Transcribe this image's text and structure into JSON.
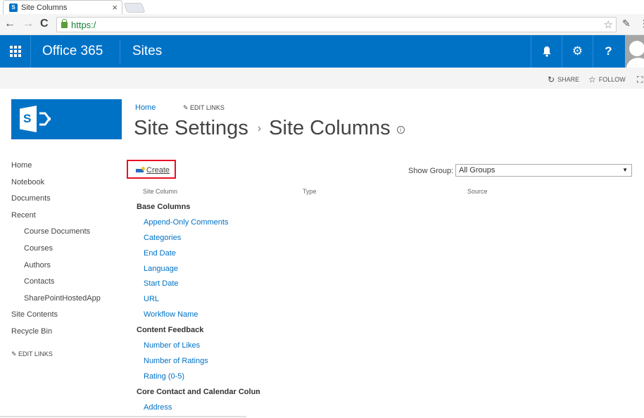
{
  "browser": {
    "tab_title": "Site Columns",
    "tab_favicon": "S",
    "url": "https:/",
    "back_icon": "←",
    "forward_icon": "→",
    "reload_icon": "C",
    "star_icon": "☆",
    "close_icon": "×"
  },
  "suite_bar": {
    "brand": "Office 365",
    "app": "Sites",
    "bell_icon": "🔔",
    "gear_icon": "⚙",
    "help_icon": "?",
    "colors": {
      "bar": "#0072c6"
    }
  },
  "share_bar": {
    "share_label": "SHARE",
    "follow_label": "FOLLOW"
  },
  "header": {
    "breadcrumb_home": "Home",
    "edit_links": "EDIT LINKS",
    "title_parent": "Site Settings",
    "title_separator": "›",
    "title_current": "Site Columns",
    "info_icon": "i"
  },
  "quick_launch": {
    "items": [
      {
        "label": "Home",
        "sub": false
      },
      {
        "label": "Notebook",
        "sub": false
      },
      {
        "label": "Documents",
        "sub": false
      },
      {
        "label": "Recent",
        "sub": false
      },
      {
        "label": "Course Documents",
        "sub": true
      },
      {
        "label": "Courses",
        "sub": true
      },
      {
        "label": "Authors",
        "sub": true
      },
      {
        "label": "Contacts",
        "sub": true
      },
      {
        "label": "SharePointHostedApp",
        "sub": true
      },
      {
        "label": "Site Contents",
        "sub": false
      },
      {
        "label": "Recycle Bin",
        "sub": false
      }
    ],
    "edit_links": "EDIT LINKS"
  },
  "content": {
    "create_label": "Create",
    "show_group_label": "Show Group:",
    "show_group_value": "All Groups",
    "columns": [
      "Site Column",
      "Type",
      "Source"
    ],
    "groups": [
      {
        "name": "Base Columns",
        "items": [
          "Append-Only Comments",
          "Categories",
          "End Date",
          "Language",
          "Start Date",
          "URL",
          "Workflow Name"
        ]
      },
      {
        "name": "Content Feedback",
        "items": [
          "Number of Likes",
          "Number of Ratings",
          "Rating (0-5)"
        ]
      },
      {
        "name": "Core Contact and Calendar Columns",
        "items": [
          "Address"
        ]
      }
    ]
  }
}
